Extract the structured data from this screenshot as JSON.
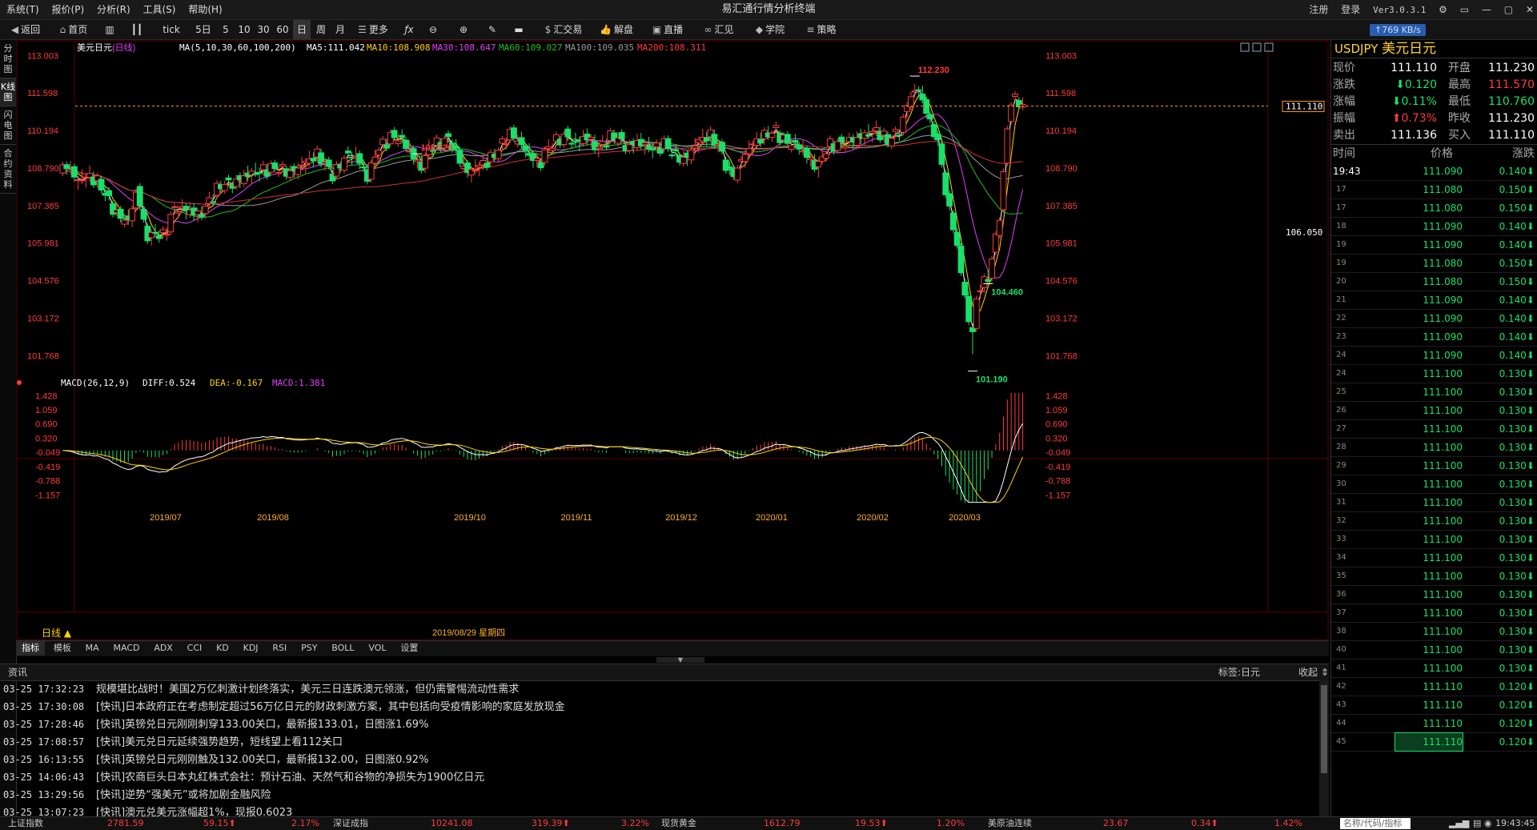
{
  "app": {
    "title": "易汇通行情分析终端",
    "menu": [
      "系统(T)",
      "报价(P)",
      "分析(R)",
      "工具(S)",
      "帮助(H)"
    ],
    "right_links": [
      "注册",
      "登录"
    ],
    "version": "Ver3.0.3.1"
  },
  "toolbar": {
    "items": [
      {
        "label": "返回",
        "icon": "back-icon"
      },
      {
        "label": "首页",
        "icon": "home-icon"
      },
      {
        "label": "",
        "icon": "chart-icon"
      },
      {
        "label": "",
        "icon": "candle-icon"
      },
      {
        "label": "tick",
        "icon": ""
      },
      {
        "label": "5日",
        "icon": ""
      },
      {
        "label": "5",
        "icon": ""
      },
      {
        "label": "10",
        "icon": ""
      },
      {
        "label": "30",
        "icon": ""
      },
      {
        "label": "60",
        "icon": ""
      },
      {
        "label": "日",
        "icon": ""
      },
      {
        "label": "周",
        "icon": ""
      },
      {
        "label": "月",
        "icon": ""
      },
      {
        "label": "更多",
        "icon": "more-icon"
      },
      {
        "label": "",
        "icon": "fx-icon"
      },
      {
        "label": "",
        "icon": "zoom-out-icon"
      },
      {
        "label": "",
        "icon": "zoom-in-icon"
      },
      {
        "label": "",
        "icon": "pen-icon"
      },
      {
        "label": "汇交易",
        "icon": "dollar-icon"
      },
      {
        "label": "解盘",
        "icon": "thumb-icon"
      },
      {
        "label": "直播",
        "icon": "tv-icon"
      },
      {
        "label": "汇见",
        "icon": "link-icon"
      },
      {
        "label": "学院",
        "icon": "academy-icon"
      },
      {
        "label": "策略",
        "icon": "strategy-icon"
      }
    ]
  },
  "sidetabs": [
    "分时图",
    "K线图",
    "闪电图",
    "合约资料"
  ],
  "chart": {
    "symbol_label": "美元日元",
    "period": "(日线)",
    "ma_header": {
      "name": "MA(5,10,30,60,100,200)",
      "ma5": "MA5:111.042",
      "ma10": "MA10:108.908",
      "ma30": "MA30:108.647",
      "ma60": "MA60:109.027",
      "ma100": "MA100:109.035",
      "ma200": "MA200:108.311"
    },
    "macd_header": {
      "name": "MACD(26,12,9)",
      "diff": "DIFF:0.524",
      "dea": "DEA:-0.167",
      "macd": "MACD:1.381"
    },
    "current_price_tag": "111.110",
    "price_106_tag": "106.050",
    "period_selector": "日线 ▲",
    "cursor_date": "2019/08/29 星期四",
    "colors": {
      "up": "#ff3b3b",
      "down": "#19e06a",
      "ma5": "#ffffff",
      "ma10": "#ffd200",
      "ma30": "#e040fb",
      "ma60": "#1fbf1f",
      "ma100": "#9a9a9a",
      "ma200": "#d03030",
      "price_axis": "#ff3b3b",
      "grid": "#3a0000"
    }
  },
  "chart_data": [
    {
      "type": "candlestick",
      "title": "美元日元(日线)",
      "y_ticks": [
        "113.003",
        "111.598",
        "110.194",
        "108.790",
        "107.385",
        "105.981",
        "104.576",
        "103.172",
        "101.768"
      ],
      "ylim": [
        101.0,
        113.4
      ],
      "x_ticks": [
        "2019/07",
        "2019/08",
        "2019/10",
        "2019/11",
        "2019/12",
        "2020/01",
        "2020/02",
        "2020/03"
      ],
      "annotations": [
        "112.230",
        "109.320",
        "104.460",
        "101.190"
      ],
      "anchors": [
        [
          0,
          108.6
        ],
        [
          10,
          108.9
        ],
        [
          22,
          108.3
        ],
        [
          38,
          108.5
        ],
        [
          52,
          108.2
        ],
        [
          65,
          107.5
        ],
        [
          75,
          107.0
        ],
        [
          90,
          106.8
        ],
        [
          100,
          108.0
        ],
        [
          112,
          106.3
        ],
        [
          118,
          106.2
        ],
        [
          125,
          106.4
        ],
        [
          135,
          106.2
        ],
        [
          148,
          107.3
        ],
        [
          168,
          107.2
        ],
        [
          182,
          107.0
        ],
        [
          195,
          107.6
        ],
        [
          210,
          108.2
        ],
        [
          225,
          108.2
        ],
        [
          240,
          108.5
        ],
        [
          262,
          108.7
        ],
        [
          280,
          108.8
        ],
        [
          300,
          108.6
        ],
        [
          318,
          109.0
        ],
        [
          335,
          109.3
        ],
        [
          355,
          108.5
        ],
        [
          372,
          109.3
        ],
        [
          385,
          109.2
        ],
        [
          400,
          108.4
        ],
        [
          410,
          109.4
        ],
        [
          424,
          109.8
        ],
        [
          432,
          110.0
        ],
        [
          445,
          109.8
        ],
        [
          458,
          109.2
        ],
        [
          470,
          108.8
        ],
        [
          478,
          109.5
        ],
        [
          492,
          109.7
        ],
        [
          505,
          109.9
        ],
        [
          520,
          109.0
        ],
        [
          530,
          108.6
        ],
        [
          545,
          108.9
        ],
        [
          558,
          109.1
        ],
        [
          572,
          109.6
        ],
        [
          583,
          110.1
        ],
        [
          595,
          109.8
        ],
        [
          608,
          109.3
        ],
        [
          622,
          108.9
        ],
        [
          634,
          109.6
        ],
        [
          645,
          109.8
        ],
        [
          656,
          110.0
        ],
        [
          668,
          109.7
        ],
        [
          682,
          110.0
        ],
        [
          698,
          109.5
        ],
        [
          712,
          109.9
        ],
        [
          722,
          110.0
        ],
        [
          736,
          109.5
        ],
        [
          748,
          109.8
        ],
        [
          760,
          109.6
        ],
        [
          773,
          109.5
        ],
        [
          784,
          109.7
        ],
        [
          800,
          109.2
        ],
        [
          812,
          109.1
        ],
        [
          822,
          109.6
        ],
        [
          832,
          109.9
        ],
        [
          846,
          110.0
        ],
        [
          858,
          109.4
        ],
        [
          868,
          108.6
        ],
        [
          876,
          108.6
        ],
        [
          888,
          109.3
        ],
        [
          899,
          109.7
        ],
        [
          914,
          110.0
        ],
        [
          928,
          110.2
        ],
        [
          940,
          109.8
        ],
        [
          958,
          109.6
        ],
        [
          970,
          109.2
        ],
        [
          982,
          108.8
        ],
        [
          996,
          109.6
        ],
        [
          1012,
          109.7
        ],
        [
          1026,
          109.8
        ],
        [
          1042,
          110.0
        ],
        [
          1060,
          110.2
        ],
        [
          1073,
          109.8
        ],
        [
          1082,
          110.0
        ],
        [
          1092,
          110.3
        ],
        [
          1100,
          111.3
        ],
        [
          1112,
          111.8
        ],
        [
          1120,
          111.3
        ],
        [
          1128,
          110.5
        ],
        [
          1136,
          110.1
        ],
        [
          1145,
          108.8
        ],
        [
          1152,
          107.3
        ],
        [
          1160,
          106.6
        ],
        [
          1168,
          105.0
        ],
        [
          1176,
          103.8
        ],
        [
          1182,
          102.2
        ],
        [
          1190,
          104.1
        ],
        [
          1198,
          104.5
        ],
        [
          1206,
          104.8
        ],
        [
          1214,
          106.2
        ],
        [
          1222,
          107.6
        ],
        [
          1230,
          110.8
        ],
        [
          1238,
          111.5
        ],
        [
          1246,
          111.1
        ],
        [
          1252,
          111.1
        ]
      ],
      "price_now": 111.11
    },
    {
      "type": "macd",
      "y_ticks": [
        "1.428",
        "1.059",
        "0.690",
        "0.320",
        "-0.049",
        "-0.419",
        "-0.788",
        "-1.157"
      ],
      "ylim": [
        -1.4,
        1.6
      ]
    }
  ],
  "bottom_tabs": [
    "指标",
    "模板",
    "MA",
    "MACD",
    "ADX",
    "CCI",
    "KD",
    "KDJ",
    "RSI",
    "PSY",
    "BOLL",
    "VOL",
    "设置"
  ],
  "news": {
    "header": "资讯",
    "tag_label": "标签:日元",
    "collapse": "收起",
    "items": [
      {
        "time": "03-25 17:32:23",
        "text": "规模堪比战时！美国2万亿刺激计划终落实，美元三日连跌澳元领涨，但仍需警惕流动性需求"
      },
      {
        "time": "03-25 17:30:08",
        "text": "[快讯]日本政府正在考虑制定超过56万亿日元的财政刺激方案，其中包括向受疫情影响的家庭发放现金"
      },
      {
        "time": "03-25 17:28:46",
        "text": "[快讯]英镑兑日元刚刚刺穿133.00关口，最新报133.01，日图涨1.69%"
      },
      {
        "time": "03-25 17:08:57",
        "text": "[快讯]美元兑日元延续强势趋势，短线望上看112关口"
      },
      {
        "time": "03-25 16:13:55",
        "text": "[快讯]英镑兑日元刚刚触及132.00关口，最新报132.00，日图涨0.92%"
      },
      {
        "time": "03-25 14:06:43",
        "text": "[快讯]农商巨头日本丸红株式会社：预计石油、天然气和谷物的净损失为1900亿日元"
      },
      {
        "time": "03-25 13:29:56",
        "text": "[快讯]逆势“强美元”或将加剧金融风险"
      },
      {
        "time": "03-25 13:07:23",
        "text": "[快讯]澳元兑美元涨幅超1%，现报0.6023"
      }
    ]
  },
  "quote": {
    "code": "USDJPY",
    "name": "美元日元",
    "net_speed": "↑769 KB/s",
    "rows": [
      {
        "l1": "现价",
        "v1": "111.110",
        "l2": "开盘",
        "v2": "111.230",
        "c1": "#ffffff",
        "c2": "#ffffff"
      },
      {
        "l1": "涨跌",
        "v1": "⬇0.120",
        "l2": "最高",
        "v2": "111.570",
        "c1": "#19e06a",
        "c2": "#ff3b3b"
      },
      {
        "l1": "涨幅",
        "v1": "⬇0.11%",
        "l2": "最低",
        "v2": "110.760",
        "c1": "#19e06a",
        "c2": "#19e06a"
      },
      {
        "l1": "振幅",
        "v1": "⬆0.73%",
        "l2": "昨收",
        "v2": "111.230",
        "c1": "#ff3b3b",
        "c2": "#ffffff"
      },
      {
        "l1": "卖出",
        "v1": "111.136",
        "l2": "买入",
        "v2": "111.110",
        "c1": "#ffffff",
        "c2": "#ffffff"
      }
    ],
    "tick_head": {
      "time": "时间",
      "price": "价格",
      "change": "涨跌"
    },
    "ticks": [
      {
        "t": "19:43",
        "p": "111.090",
        "c": "0.140⬇"
      },
      {
        "t": "17",
        "p": "111.080",
        "c": "0.150⬇"
      },
      {
        "t": "17",
        "p": "111.080",
        "c": "0.150⬇"
      },
      {
        "t": "18",
        "p": "111.090",
        "c": "0.140⬇"
      },
      {
        "t": "19",
        "p": "111.090",
        "c": "0.140⬇"
      },
      {
        "t": "19",
        "p": "111.080",
        "c": "0.150⬇"
      },
      {
        "t": "20",
        "p": "111.080",
        "c": "0.150⬇"
      },
      {
        "t": "21",
        "p": "111.090",
        "c": "0.140⬇"
      },
      {
        "t": "22",
        "p": "111.090",
        "c": "0.140⬇"
      },
      {
        "t": "23",
        "p": "111.090",
        "c": "0.140⬇"
      },
      {
        "t": "24",
        "p": "111.090",
        "c": "0.140⬇"
      },
      {
        "t": "24",
        "p": "111.100",
        "c": "0.130⬇"
      },
      {
        "t": "25",
        "p": "111.100",
        "c": "0.130⬇"
      },
      {
        "t": "26",
        "p": "111.100",
        "c": "0.130⬇"
      },
      {
        "t": "27",
        "p": "111.100",
        "c": "0.130⬇"
      },
      {
        "t": "28",
        "p": "111.100",
        "c": "0.130⬇"
      },
      {
        "t": "29",
        "p": "111.100",
        "c": "0.130⬇"
      },
      {
        "t": "30",
        "p": "111.100",
        "c": "0.130⬇"
      },
      {
        "t": "31",
        "p": "111.100",
        "c": "0.130⬇"
      },
      {
        "t": "32",
        "p": "111.100",
        "c": "0.130⬇"
      },
      {
        "t": "33",
        "p": "111.100",
        "c": "0.130⬇"
      },
      {
        "t": "34",
        "p": "111.100",
        "c": "0.130⬇"
      },
      {
        "t": "35",
        "p": "111.100",
        "c": "0.130⬇"
      },
      {
        "t": "36",
        "p": "111.100",
        "c": "0.130⬇"
      },
      {
        "t": "37",
        "p": "111.100",
        "c": "0.130⬇"
      },
      {
        "t": "38",
        "p": "111.100",
        "c": "0.130⬇"
      },
      {
        "t": "40",
        "p": "111.100",
        "c": "0.130⬇"
      },
      {
        "t": "41",
        "p": "111.100",
        "c": "0.130⬇"
      },
      {
        "t": "42",
        "p": "111.110",
        "c": "0.120⬇"
      },
      {
        "t": "43",
        "p": "111.110",
        "c": "0.120⬇"
      },
      {
        "t": "44",
        "p": "111.110",
        "c": "0.120⬇"
      },
      {
        "t": "45",
        "p": "111.110",
        "c": "0.120⬇"
      }
    ],
    "search_placeholder": "名称/代码/指标"
  },
  "status": [
    {
      "name": "上证指数",
      "v": "2781.59",
      "ch": "59.15⬆",
      "pct": "2.17%"
    },
    {
      "name": "深证成指",
      "v": "10241.08",
      "ch": "319.39⬆",
      "pct": "3.22%"
    },
    {
      "name": "现货黄金",
      "v": "1612.79",
      "ch": "19.53⬆",
      "pct": "1.20%"
    },
    {
      "name": "美原油连续",
      "v": "23.67",
      "ch": "0.34⬆",
      "pct": "1.42%"
    }
  ],
  "clock": "19:43:45"
}
